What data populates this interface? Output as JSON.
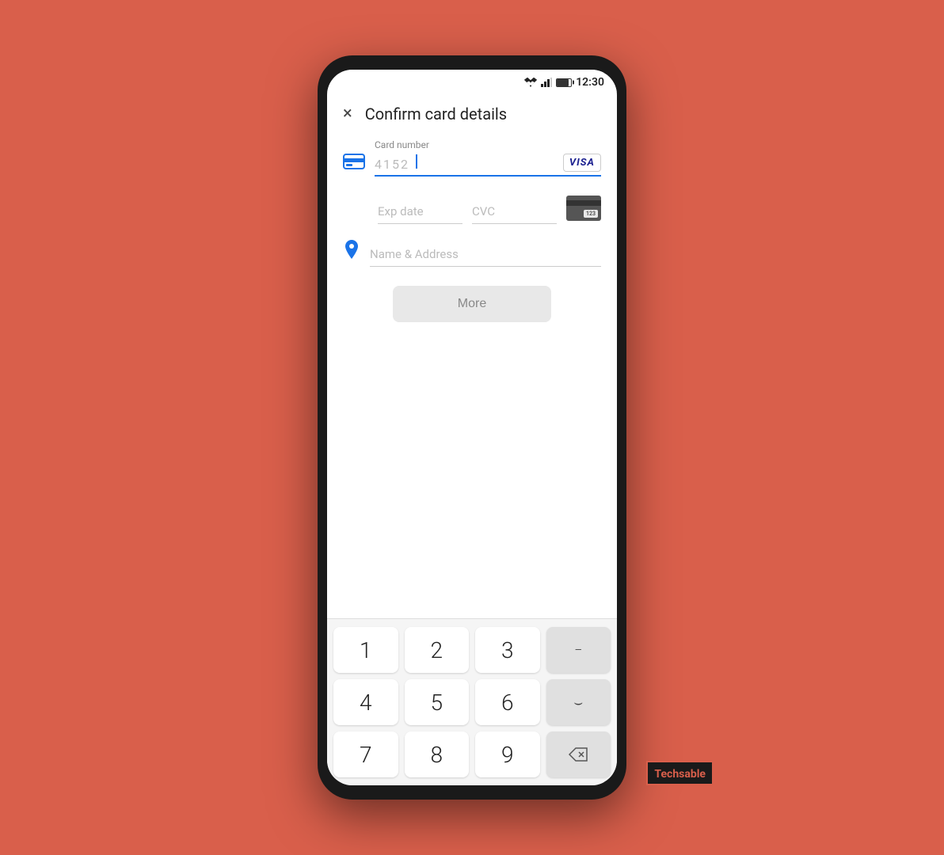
{
  "statusBar": {
    "time": "12:30"
  },
  "header": {
    "closeLabel": "×",
    "title": "Confirm card details"
  },
  "form": {
    "cardNumber": {
      "label": "Card number",
      "value": "4152",
      "cardType": "VISA"
    },
    "expDate": {
      "placeholder": "Exp date"
    },
    "cvc": {
      "placeholder": "CVC",
      "cvcHint": "123"
    },
    "nameAddress": {
      "placeholder": "Name & Address"
    }
  },
  "moreButton": {
    "label": "More"
  },
  "keyboard": {
    "rows": [
      [
        "1",
        "2",
        "3",
        "−"
      ],
      [
        "4",
        "5",
        "6",
        "⌫space"
      ],
      [
        "7",
        "8",
        "9",
        "⌫del"
      ]
    ],
    "keys": [
      [
        "1",
        "2",
        "3",
        "dash"
      ],
      [
        "4",
        "5",
        "6",
        "space"
      ],
      [
        "7",
        "8",
        "9",
        "backspace"
      ]
    ]
  },
  "watermark": {
    "text": "Techsable"
  }
}
